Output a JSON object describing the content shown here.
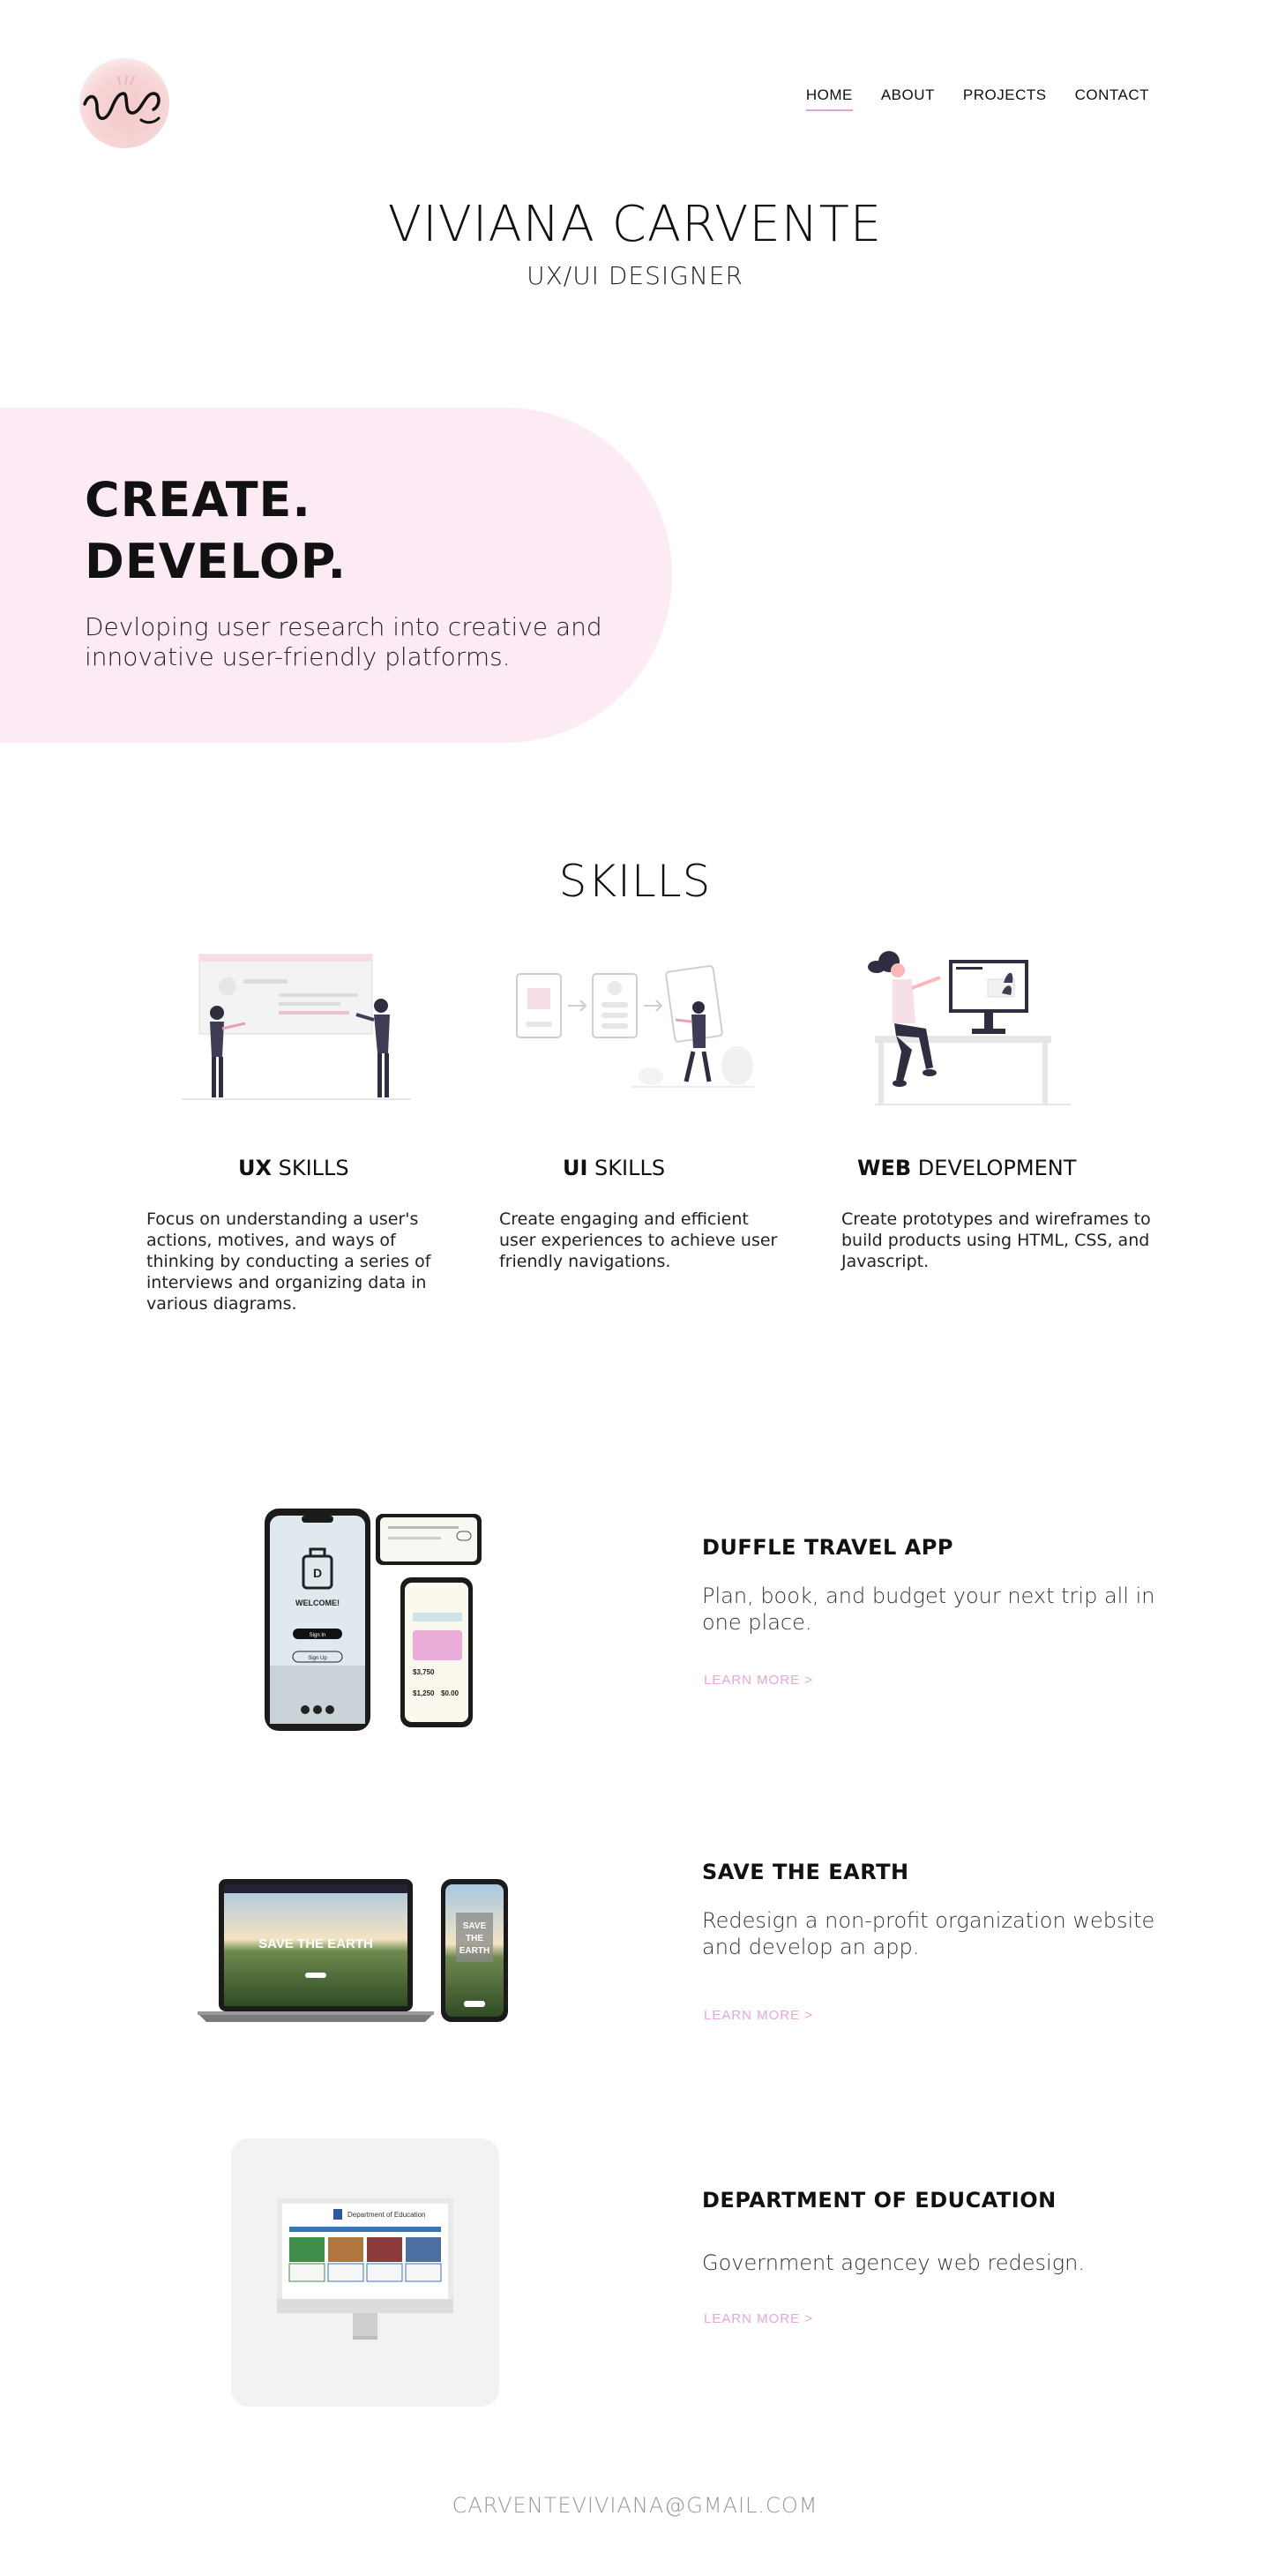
{
  "header": {
    "logo_text": "vc",
    "nav": [
      {
        "label": "HOME",
        "active": true
      },
      {
        "label": "ABOUT",
        "active": false
      },
      {
        "label": "PROJECTS",
        "active": false
      },
      {
        "label": "CONTACT",
        "active": false
      }
    ]
  },
  "hero": {
    "name": "VIVIANA CARVENTE",
    "role": "UX/UI DESIGNER"
  },
  "banner": {
    "line1": "CREATE.",
    "line2": "DEVELOP.",
    "description": "Devloping user research into creative and innovative user-friendly platforms."
  },
  "skills": {
    "title": "SKILLS",
    "items": [
      {
        "bold": "UX",
        "rest": " SKILLS",
        "description": "Focus on understanding a user's actions, motives, and ways of thinking by conducting a series of interviews and organizing data in various diagrams."
      },
      {
        "bold": "UI",
        "rest": " SKILLS",
        "description": "Create engaging and efficient user experiences to achieve user friendly navigations."
      },
      {
        "bold": "WEB",
        "rest": " DEVELOPMENT",
        "description": "Create prototypes and wireframes to build products using HTML, CSS, and Javascript."
      }
    ]
  },
  "projects": [
    {
      "title": "DUFFLE TRAVEL APP",
      "description": "Plan, book, and budget your next trip all in one place.",
      "link": "LEARN MORE >",
      "mock": {
        "welcome": "WELCOME!",
        "sign_in": "Sign In",
        "sign_up": "Sign Up",
        "amount1": "$3,750",
        "amount2": "$1,250",
        "amount3": "$0.00"
      }
    },
    {
      "title": "SAVE THE EARTH",
      "description": "Redesign a non-profit organization website and develop an app.",
      "link": "LEARN MORE >",
      "mock": {
        "headline": "SAVE THE EARTH",
        "phone_headline_1": "SAVE",
        "phone_headline_2": "THE",
        "phone_headline_3": "EARTH"
      }
    },
    {
      "title": "DEPARTMENT OF EDUCATION",
      "description": "Government agencey web redesign.",
      "link": "LEARN MORE >",
      "mock": {
        "site_title": "Department of Education"
      }
    }
  ],
  "footer": {
    "email": "CARVENTEVIVIANA@GMAIL.COM"
  },
  "colors": {
    "accent_pink": "#e7a5d8",
    "banner_bg": "#fcebf4",
    "logo_pink": "#f4c9c9",
    "text_dark": "#111111"
  }
}
